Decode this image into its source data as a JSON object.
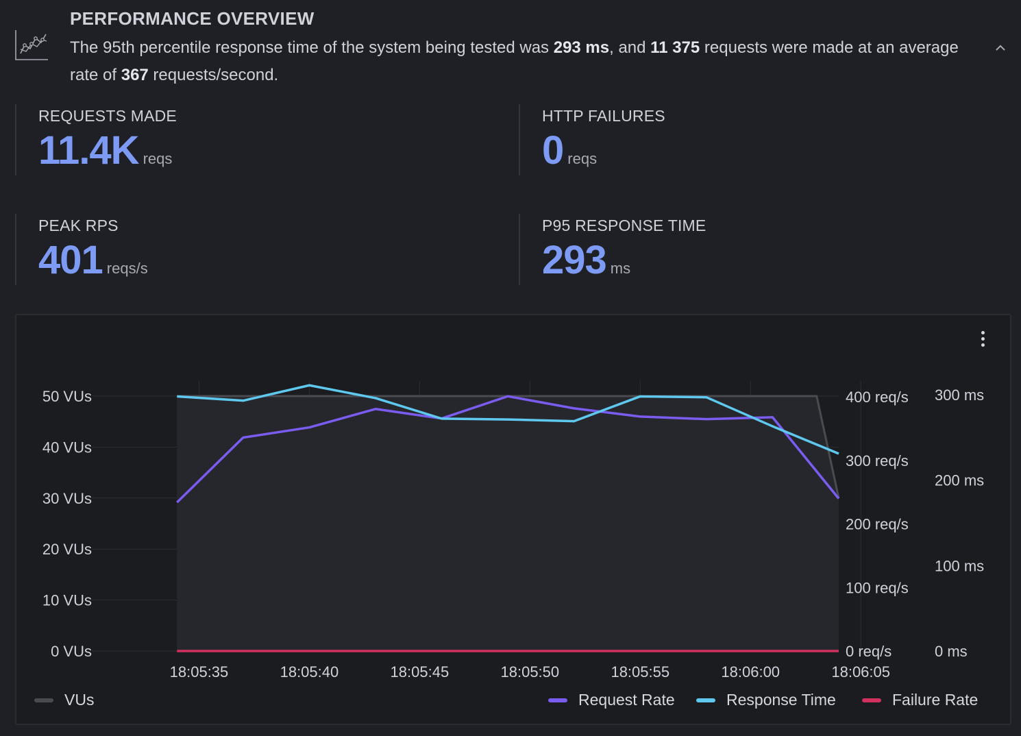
{
  "header": {
    "title": "PERFORMANCE OVERVIEW",
    "desc_part1": "The 95th percentile response time of the system being tested was ",
    "desc_p95": "293 ms",
    "desc_part2": ", and ",
    "desc_requests": "11 375",
    "desc_part3": " requests were made at an average rate of ",
    "desc_rate": "367",
    "desc_part4": " requests/second.",
    "icon": "chart-line-icon",
    "collapse_icon": "chevron-up-icon"
  },
  "stats": {
    "requests_made": {
      "label": "REQUESTS MADE",
      "value": "11.4K",
      "unit": "reqs"
    },
    "http_failures": {
      "label": "HTTP FAILURES",
      "value": "0",
      "unit": "reqs"
    },
    "peak_rps": {
      "label": "PEAK RPS",
      "value": "401",
      "unit": "reqs/s"
    },
    "p95_response_time": {
      "label": "P95 RESPONSE TIME",
      "value": "293",
      "unit": "ms"
    }
  },
  "colors": {
    "accent_value": "#7d9bf5",
    "vus": "#4a4b50",
    "request_rate": "#7b5cf0",
    "response_time": "#5ec8ef",
    "failure_rate": "#d0305e"
  },
  "chart_data": {
    "type": "line",
    "x": [
      "18:05:34",
      "18:05:37",
      "18:05:40",
      "18:05:43",
      "18:05:46",
      "18:05:49",
      "18:05:52",
      "18:05:55",
      "18:05:58",
      "18:06:01",
      "18:06:04"
    ],
    "x_ticks": [
      "18:05:35",
      "18:05:40",
      "18:05:45",
      "18:05:50",
      "18:05:55",
      "18:06:00",
      "18:06:05"
    ],
    "y_left": {
      "ticks": [
        "0 VUs",
        "10 VUs",
        "20 VUs",
        "30 VUs",
        "40 VUs",
        "50 VUs"
      ],
      "ylim": [
        0,
        50
      ]
    },
    "y_right_rate": {
      "ticks": [
        "0 req/s",
        "100 req/s",
        "200 req/s",
        "300 req/s",
        "400 req/s"
      ],
      "ylim": [
        0,
        425
      ]
    },
    "y_right_time": {
      "ticks": [
        "0 ms",
        "100 ms",
        "200 ms",
        "300 ms"
      ],
      "ylim": [
        0,
        316
      ]
    },
    "series": [
      {
        "name": "VUs",
        "axis": "left",
        "x": [
          "18:05:34",
          "18:06:03",
          "18:06:04"
        ],
        "values": [
          50,
          50,
          30
        ]
      },
      {
        "name": "Request Rate",
        "axis": "rate",
        "values": [
          234,
          336,
          352,
          381,
          366,
          401,
          382,
          369,
          365,
          368,
          240
        ]
      },
      {
        "name": "Response Time",
        "axis": "time",
        "values": [
          298,
          293,
          311,
          296,
          272,
          271,
          269,
          298,
          297,
          263,
          231
        ]
      },
      {
        "name": "Failure Rate",
        "axis": "rate",
        "values": [
          0,
          0,
          0,
          0,
          0,
          0,
          0,
          0,
          0,
          0,
          0
        ]
      }
    ],
    "grid": true,
    "legend": {
      "left": [
        "VUs"
      ],
      "right": [
        "Request Rate",
        "Response Time",
        "Failure Rate"
      ]
    }
  }
}
